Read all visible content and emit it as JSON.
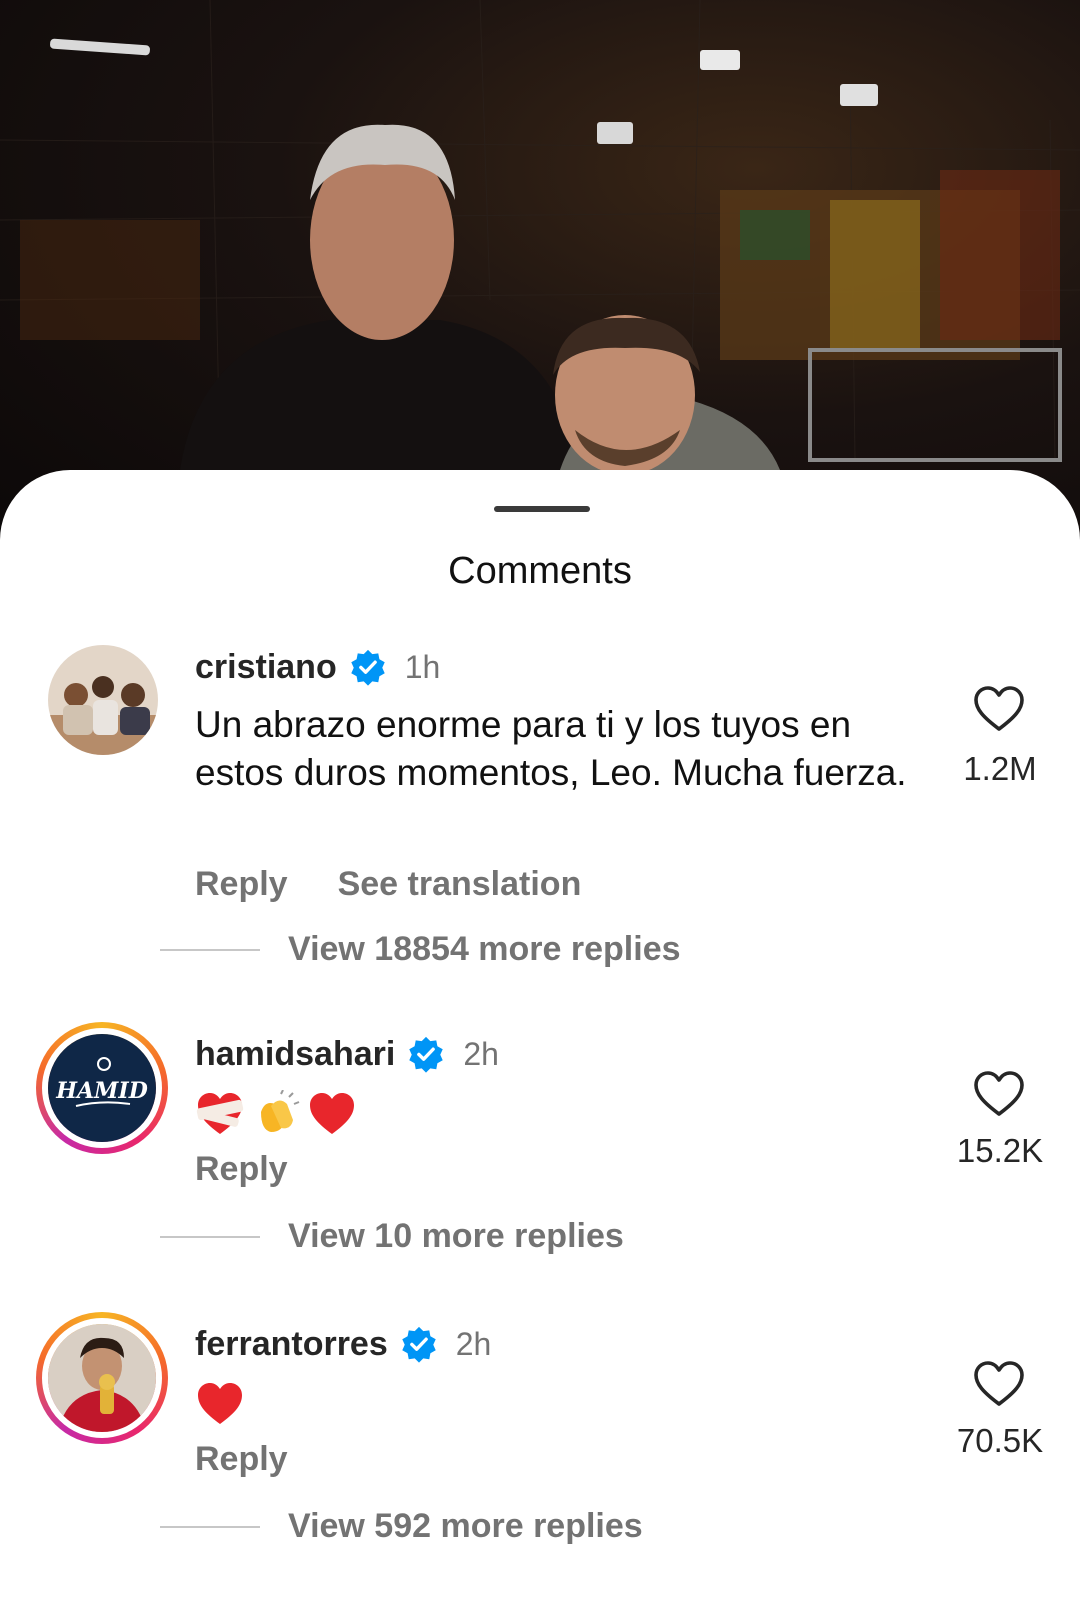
{
  "sheet": {
    "title": "Comments"
  },
  "comments": [
    {
      "username": "cristiano",
      "time": "1h",
      "text": "Un abrazo enorme para ti y los tuyos en estos duros momentos, Leo. Mucha fuerza.",
      "reply_label": "Reply",
      "translate_label": "See translation",
      "likes": "1.2M",
      "more_replies": "View 18854 more replies"
    },
    {
      "username": "hamidsahari",
      "time": "2h",
      "emojis": [
        "heart-with-bandage",
        "clapping-hands",
        "red-heart"
      ],
      "avatar_text": "HAMID",
      "reply_label": "Reply",
      "likes": "15.2K",
      "more_replies": "View 10 more replies"
    },
    {
      "username": "ferrantorres",
      "time": "2h",
      "emojis": [
        "red-heart"
      ],
      "reply_label": "Reply",
      "likes": "70.5K",
      "more_replies": "View 592 more replies"
    }
  ],
  "colors": {
    "verified": "#0095f6",
    "heart": "#e8262c",
    "muted_text": "#737373"
  }
}
